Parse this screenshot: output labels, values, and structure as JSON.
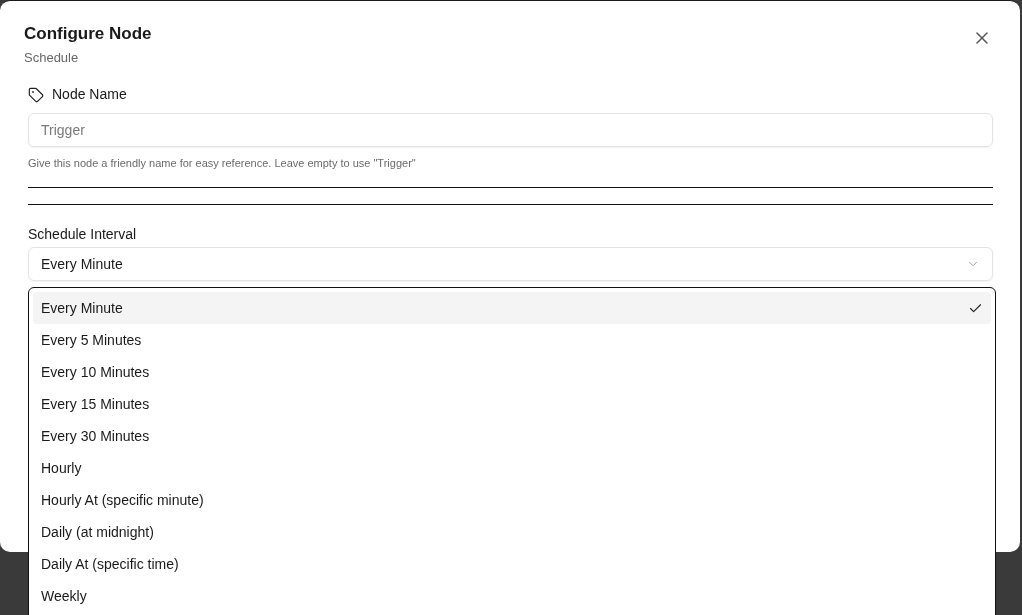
{
  "dialog": {
    "title": "Configure Node",
    "subtitle": "Schedule"
  },
  "node_name": {
    "label": "Node Name",
    "placeholder": "Trigger",
    "help": "Give this node a friendly name for easy reference. Leave empty to use \"Trigger\""
  },
  "schedule_interval": {
    "label": "Schedule Interval",
    "value": "Every Minute",
    "expanded": true
  },
  "options": [
    {
      "label": "Every Minute",
      "selected": true
    },
    {
      "label": "Every 5 Minutes",
      "selected": false
    },
    {
      "label": "Every 10 Minutes",
      "selected": false
    },
    {
      "label": "Every 15 Minutes",
      "selected": false
    },
    {
      "label": "Every 30 Minutes",
      "selected": false
    },
    {
      "label": "Hourly",
      "selected": false
    },
    {
      "label": "Hourly At (specific minute)",
      "selected": false
    },
    {
      "label": "Daily (at midnight)",
      "selected": false
    },
    {
      "label": "Daily At (specific time)",
      "selected": false
    },
    {
      "label": "Weekly",
      "selected": false
    }
  ]
}
